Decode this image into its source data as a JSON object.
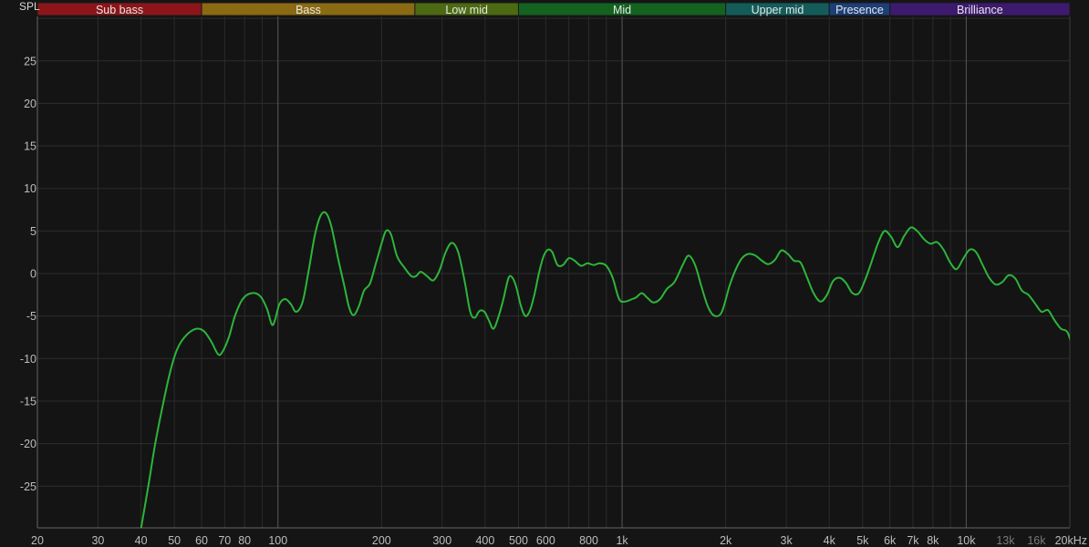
{
  "chart_data": {
    "type": "line",
    "ylabel": "SPL",
    "ylim": [
      -30,
      30
    ],
    "xlim": [
      20,
      20000
    ],
    "x_scale": "log",
    "grid": true,
    "y_ticks": [
      25,
      20,
      15,
      10,
      5,
      0,
      -5,
      -10,
      -15,
      -20,
      -25
    ],
    "x_ticks": [
      {
        "value": 20,
        "label": "20"
      },
      {
        "value": 30,
        "label": "30"
      },
      {
        "value": 40,
        "label": "40"
      },
      {
        "value": 50,
        "label": "50"
      },
      {
        "value": 60,
        "label": "60"
      },
      {
        "value": 70,
        "label": "70"
      },
      {
        "value": 80,
        "label": "80"
      },
      {
        "value": 100,
        "label": "100"
      },
      {
        "value": 200,
        "label": "200"
      },
      {
        "value": 300,
        "label": "300"
      },
      {
        "value": 400,
        "label": "400"
      },
      {
        "value": 500,
        "label": "500"
      },
      {
        "value": 600,
        "label": "600"
      },
      {
        "value": 800,
        "label": "800"
      },
      {
        "value": 1000,
        "label": "1k"
      },
      {
        "value": 2000,
        "label": "2k"
      },
      {
        "value": 3000,
        "label": "3k"
      },
      {
        "value": 4000,
        "label": "4k"
      },
      {
        "value": 5000,
        "label": "5k"
      },
      {
        "value": 6000,
        "label": "6k"
      },
      {
        "value": 7000,
        "label": "7k"
      },
      {
        "value": 8000,
        "label": "8k"
      },
      {
        "value": 10000,
        "label": "10k"
      },
      {
        "value": 13000,
        "label": "13k",
        "dim": true
      },
      {
        "value": 16000,
        "label": "16k",
        "dim": true
      },
      {
        "value": 20000,
        "label": "20kHz"
      }
    ],
    "bands": [
      {
        "name": "Sub bass",
        "from": 20,
        "to": 60,
        "color": "#8b1519"
      },
      {
        "name": "Bass",
        "from": 60,
        "to": 250,
        "color": "#8a6a12"
      },
      {
        "name": "Low mid",
        "from": 250,
        "to": 500,
        "color": "#4c6a12"
      },
      {
        "name": "Mid",
        "from": 500,
        "to": 2000,
        "color": "#13621f"
      },
      {
        "name": "Upper mid",
        "from": 2000,
        "to": 4000,
        "color": "#145c5a"
      },
      {
        "name": "Presence",
        "from": 4000,
        "to": 6000,
        "color": "#1c3f78"
      },
      {
        "name": "Brilliance",
        "from": 6000,
        "to": 20000,
        "color": "#3e1a6e"
      }
    ],
    "line_color": "#2db53a",
    "points": [
      [
        40,
        -30
      ],
      [
        42,
        -25
      ],
      [
        44,
        -20
      ],
      [
        46,
        -16
      ],
      [
        48,
        -12.5
      ],
      [
        50,
        -9.8
      ],
      [
        52,
        -8.2
      ],
      [
        55,
        -7
      ],
      [
        58,
        -6.5
      ],
      [
        61,
        -6.8
      ],
      [
        64,
        -8
      ],
      [
        67,
        -9.5
      ],
      [
        69,
        -9.2
      ],
      [
        72,
        -7.5
      ],
      [
        75,
        -5
      ],
      [
        79,
        -3
      ],
      [
        84,
        -2.3
      ],
      [
        89,
        -2.7
      ],
      [
        93,
        -4.2
      ],
      [
        96,
        -6
      ],
      [
        98,
        -5.5
      ],
      [
        101,
        -3.6
      ],
      [
        105,
        -3
      ],
      [
        109,
        -3.6
      ],
      [
        113,
        -4.5
      ],
      [
        118,
        -3.3
      ],
      [
        123,
        0.5
      ],
      [
        128,
        4.5
      ],
      [
        133,
        6.8
      ],
      [
        138,
        7.1
      ],
      [
        143,
        5.5
      ],
      [
        150,
        1.5
      ],
      [
        156,
        -1.5
      ],
      [
        161,
        -4
      ],
      [
        166,
        -4.9
      ],
      [
        172,
        -3.8
      ],
      [
        178,
        -2
      ],
      [
        185,
        -1.2
      ],
      [
        192,
        1
      ],
      [
        200,
        3.5
      ],
      [
        206,
        5
      ],
      [
        213,
        4.6
      ],
      [
        222,
        2
      ],
      [
        233,
        0.7
      ],
      [
        244,
        -0.3
      ],
      [
        252,
        -0.3
      ],
      [
        260,
        0.2
      ],
      [
        271,
        -0.3
      ],
      [
        283,
        -0.8
      ],
      [
        295,
        0.4
      ],
      [
        307,
        2.5
      ],
      [
        320,
        3.6
      ],
      [
        334,
        2.5
      ],
      [
        349,
        -1
      ],
      [
        362,
        -4.5
      ],
      [
        373,
        -5.2
      ],
      [
        385,
        -4.4
      ],
      [
        398,
        -4.5
      ],
      [
        410,
        -5.5
      ],
      [
        423,
        -6.5
      ],
      [
        438,
        -5
      ],
      [
        452,
        -3
      ],
      [
        467,
        -0.6
      ],
      [
        478,
        -0.4
      ],
      [
        492,
        -1.5
      ],
      [
        508,
        -3.8
      ],
      [
        523,
        -5
      ],
      [
        539,
        -4.4
      ],
      [
        556,
        -2.5
      ],
      [
        573,
        0
      ],
      [
        591,
        2
      ],
      [
        609,
        2.8
      ],
      [
        627,
        2.5
      ],
      [
        649,
        1
      ],
      [
        673,
        1
      ],
      [
        700,
        1.8
      ],
      [
        728,
        1.5
      ],
      [
        760,
        0.9
      ],
      [
        793,
        1.2
      ],
      [
        827,
        1
      ],
      [
        862,
        1.2
      ],
      [
        900,
        0.9
      ],
      [
        939,
        -0.5
      ],
      [
        980,
        -3
      ],
      [
        1020,
        -3.3
      ],
      [
        1070,
        -3
      ],
      [
        1100,
        -2.8
      ],
      [
        1140,
        -2.3
      ],
      [
        1180,
        -2.8
      ],
      [
        1230,
        -3.4
      ],
      [
        1290,
        -3
      ],
      [
        1350,
        -1.8
      ],
      [
        1420,
        -1
      ],
      [
        1500,
        1
      ],
      [
        1560,
        2.1
      ],
      [
        1630,
        1
      ],
      [
        1700,
        -1.5
      ],
      [
        1780,
        -4
      ],
      [
        1860,
        -5
      ],
      [
        1950,
        -4.5
      ],
      [
        2050,
        -1.5
      ],
      [
        2140,
        0.5
      ],
      [
        2230,
        1.8
      ],
      [
        2330,
        2.3
      ],
      [
        2440,
        2.1
      ],
      [
        2550,
        1.5
      ],
      [
        2660,
        1.1
      ],
      [
        2780,
        1.6
      ],
      [
        2900,
        2.7
      ],
      [
        3030,
        2.3
      ],
      [
        3160,
        1.5
      ],
      [
        3300,
        1.3
      ],
      [
        3450,
        -0.5
      ],
      [
        3600,
        -2.3
      ],
      [
        3770,
        -3.3
      ],
      [
        3940,
        -2.5
      ],
      [
        4100,
        -0.9
      ],
      [
        4290,
        -0.5
      ],
      [
        4470,
        -1.1
      ],
      [
        4670,
        -2.3
      ],
      [
        4880,
        -2.3
      ],
      [
        5100,
        -0.6
      ],
      [
        5300,
        1.3
      ],
      [
        5560,
        3.7
      ],
      [
        5790,
        5
      ],
      [
        6050,
        4.3
      ],
      [
        6320,
        3.1
      ],
      [
        6600,
        4.4
      ],
      [
        6900,
        5.4
      ],
      [
        7200,
        5
      ],
      [
        7550,
        4
      ],
      [
        7880,
        3.5
      ],
      [
        8220,
        3.7
      ],
      [
        8590,
        2.8
      ],
      [
        8980,
        1.3
      ],
      [
        9370,
        0.5
      ],
      [
        9790,
        1.7
      ],
      [
        10230,
        2.8
      ],
      [
        10690,
        2.5
      ],
      [
        11160,
        1
      ],
      [
        11660,
        -0.5
      ],
      [
        12180,
        -1.3
      ],
      [
        12730,
        -1
      ],
      [
        13290,
        -0.2
      ],
      [
        13890,
        -0.6
      ],
      [
        14510,
        -2
      ],
      [
        15150,
        -2.5
      ],
      [
        15830,
        -3.5
      ],
      [
        16540,
        -4.5
      ],
      [
        17280,
        -4.3
      ],
      [
        18050,
        -5.5
      ],
      [
        18850,
        -6.5
      ],
      [
        19690,
        -6.9
      ],
      [
        20570,
        -8.9
      ],
      [
        21490,
        -8.4
      ],
      [
        22450,
        -7.3
      ]
    ]
  }
}
